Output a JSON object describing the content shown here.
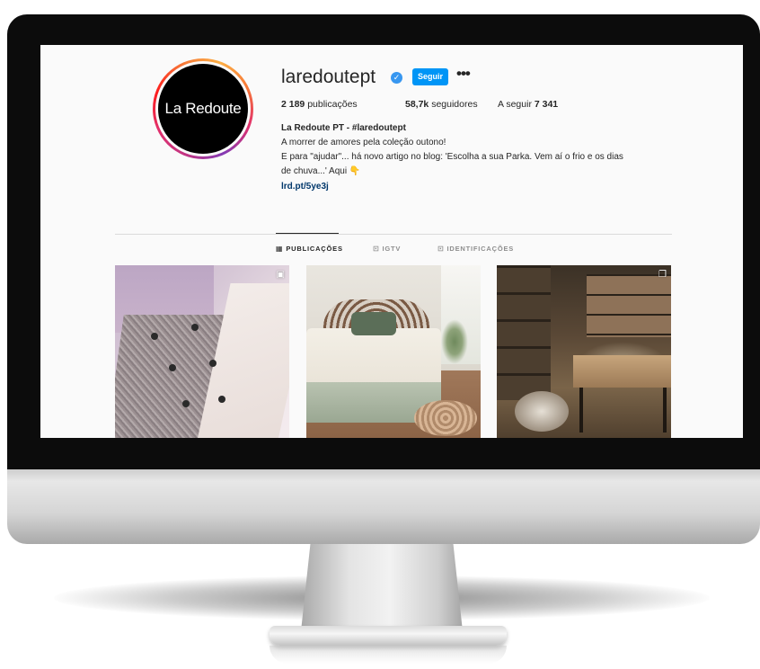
{
  "profile": {
    "username": "laredoutept",
    "avatar_text": "La Redoute",
    "follow_label": "Seguir",
    "more_label": "•••",
    "verified_glyph": "✓",
    "posts_count": "2 189",
    "posts_label": "publicações",
    "followers_count": "58,7k",
    "followers_label": "seguidores",
    "following_label": "A seguir",
    "following_count": "7 341",
    "bio_name": "La Redoute PT - #laredoutept",
    "bio_lines": [
      "A morrer de amores pela coleção outono!",
      "E para \"ajudar\"... há novo artigo no blog: 'Escolha a sua Parka. Vem aí o frio e os dias",
      "de chuva...' Aqui 👇"
    ],
    "link": "lrd.pt/5ye3j"
  },
  "tabs": [
    {
      "label": "PUBLICAÇÕES",
      "icon": "grid-icon",
      "glyph": "▦",
      "active": true
    },
    {
      "label": "IGTV",
      "icon": "igtv-icon",
      "glyph": "⊡",
      "active": false
    },
    {
      "label": "IDENTIFICAÇÕES",
      "icon": "tagged-icon",
      "glyph": "⊡",
      "active": false
    }
  ],
  "posts": [
    {
      "name": "fashion-coat-post",
      "badge_icon": "reels-icon",
      "badge_glyph": "▣"
    },
    {
      "name": "bedroom-post"
    },
    {
      "name": "room-interior-post",
      "badge_icon": "carousel-icon",
      "badge_glyph": "❐"
    }
  ],
  "colors": {
    "accent": "#0095f6",
    "verified": "#3897f0",
    "link": "#00376b",
    "text": "#262626",
    "muted": "#8e8e8e"
  }
}
